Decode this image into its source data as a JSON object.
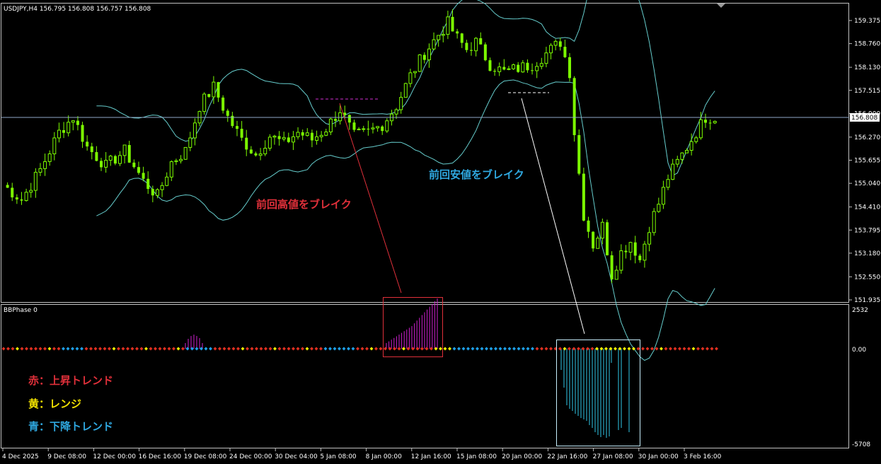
{
  "main_panel": {
    "symbol_info": "USDJPY,H4  156.795 156.808 156.757 156.808",
    "current_price": "156.808",
    "current_price_value": 156.808,
    "price_ticks": [
      "159.375",
      "158.760",
      "158.130",
      "157.515",
      "156.900",
      "156.270",
      "155.655",
      "155.040",
      "154.410",
      "153.795",
      "153.180",
      "152.550",
      "151.935"
    ],
    "annotation_high_break": "前回高値をブレイク",
    "annotation_low_break": "前回安値をブレイク",
    "colors": {
      "bull_candle": "#7CFC00",
      "band_line": "#66CDCD",
      "current_price_line": "#8FA9C8",
      "annotation_red": "#E0303A",
      "annotation_blue": "#2FA8E0",
      "dashed_high": "#D030D0",
      "dashed_low": "#FFFFFF"
    }
  },
  "indicator_panel": {
    "name": "BBPhase 0",
    "level_top": "2532",
    "level_zero": "0.00",
    "level_bottom": "-5708",
    "legend": [
      {
        "text": "赤：上昇トレンド",
        "color": "#E0303A"
      },
      {
        "text": "黄：レンジ",
        "color": "#F0E000"
      },
      {
        "text": "青：下降トレンド",
        "color": "#2FA8E0"
      }
    ],
    "colors": {
      "up_hist": "#D020D0",
      "down_hist": "#30C8E8",
      "dot_red": "#E03020",
      "dot_yellow": "#F0F000",
      "dot_blue": "#1EA0E8"
    }
  },
  "time_axis": [
    "4 Dec 2025",
    "9 Dec 08:00",
    "12 Dec 00:00",
    "16 Dec 16:00",
    "19 Dec 08:00",
    "24 Dec 00:00",
    "30 Dec 04:00",
    "5 Jan 08:00",
    "8 Jan 00:00",
    "12 Jan 16:00",
    "15 Jan 08:00",
    "20 Jan 00:00",
    "22 Jan 16:00",
    "27 Jan 08:00",
    "30 Jan 00:00",
    "3 Feb 16:00"
  ],
  "chart_data": {
    "type": "candlestick",
    "symbol": "USDJPY",
    "timeframe": "H4",
    "price_close_path": [
      [
        0,
        155.0
      ],
      [
        4,
        154.6
      ],
      [
        8,
        155.4
      ],
      [
        12,
        156.4
      ],
      [
        15,
        156.8
      ],
      [
        18,
        156.0
      ],
      [
        22,
        155.5
      ],
      [
        26,
        155.9
      ],
      [
        30,
        155.1
      ],
      [
        33,
        154.7
      ],
      [
        36,
        155.6
      ],
      [
        39,
        155.9
      ],
      [
        42,
        157.1
      ],
      [
        45,
        157.6
      ],
      [
        48,
        156.8
      ],
      [
        51,
        156.2
      ],
      [
        54,
        155.8
      ],
      [
        57,
        156.3
      ],
      [
        60,
        156.1
      ],
      [
        63,
        156.4
      ],
      [
        66,
        156.2
      ],
      [
        69,
        156.5
      ],
      [
        72,
        157.0
      ],
      [
        75,
        156.3
      ],
      [
        78,
        156.4
      ],
      [
        81,
        156.6
      ],
      [
        84,
        157.1
      ],
      [
        87,
        157.9
      ],
      [
        90,
        158.5
      ],
      [
        93,
        159.0
      ],
      [
        95,
        159.3
      ],
      [
        97,
        158.9
      ],
      [
        99,
        158.6
      ],
      [
        101,
        158.8
      ],
      [
        104,
        158.2
      ],
      [
        107,
        158.0
      ],
      [
        110,
        158.1
      ],
      [
        113,
        158.2
      ],
      [
        116,
        158.5
      ],
      [
        119,
        158.8
      ],
      [
        121,
        158.0
      ],
      [
        122,
        156.4
      ],
      [
        124,
        154.2
      ],
      [
        126,
        153.4
      ],
      [
        128,
        153.9
      ],
      [
        130,
        152.6
      ],
      [
        132,
        153.2
      ],
      [
        134,
        153.5
      ],
      [
        136,
        153.0
      ],
      [
        138,
        153.9
      ],
      [
        140,
        154.5
      ],
      [
        142,
        155.2
      ],
      [
        144,
        155.6
      ],
      [
        146,
        156.0
      ],
      [
        148,
        156.4
      ],
      [
        150,
        156.8
      ],
      [
        152,
        156.8
      ]
    ],
    "indicator_phase": "0 = range (yellow), positive histogram = uptrend (magenta), negative histogram = downtrend (cyan)"
  }
}
